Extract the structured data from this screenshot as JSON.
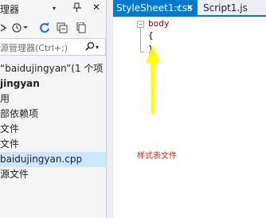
{
  "solution_explorer": {
    "title": "理器",
    "title_dropdown": "▾",
    "pin": "ᵽ",
    "close": "✕",
    "search_placeholder": "源管理器(Ctrl+;)",
    "search_dropdown": "▾",
    "tree": [
      {
        "label": "“baidujingyan”(1 个项",
        "bold": false,
        "selected": false
      },
      {
        "label": "jingyan",
        "bold": true,
        "selected": false
      },
      {
        "label": "用",
        "bold": false,
        "selected": false
      },
      {
        "label": "部依赖项",
        "bold": false,
        "selected": false
      },
      {
        "label": "文件",
        "bold": false,
        "selected": false
      },
      {
        "label": "文件",
        "bold": false,
        "selected": false
      },
      {
        "label": "baidujingyan.cpp",
        "bold": false,
        "selected": true
      },
      {
        "label": "源文件",
        "bold": false,
        "selected": false
      }
    ]
  },
  "editor": {
    "tabs": [
      {
        "label": "StyleSheet1.css",
        "active": true
      },
      {
        "label": "Script1.js",
        "active": false
      }
    ],
    "tab_pin": "⊣",
    "tab_close": "✕",
    "code": {
      "collapse_symbol": "−",
      "lines": [
        "body",
        "{",
        "}"
      ]
    },
    "annotation": "样式表文件"
  },
  "colors": {
    "accent": "#007acc",
    "selection": "#cce8ff",
    "keyword": "#800000",
    "annotation": "#e0241b",
    "arrow": "#ffff00"
  }
}
